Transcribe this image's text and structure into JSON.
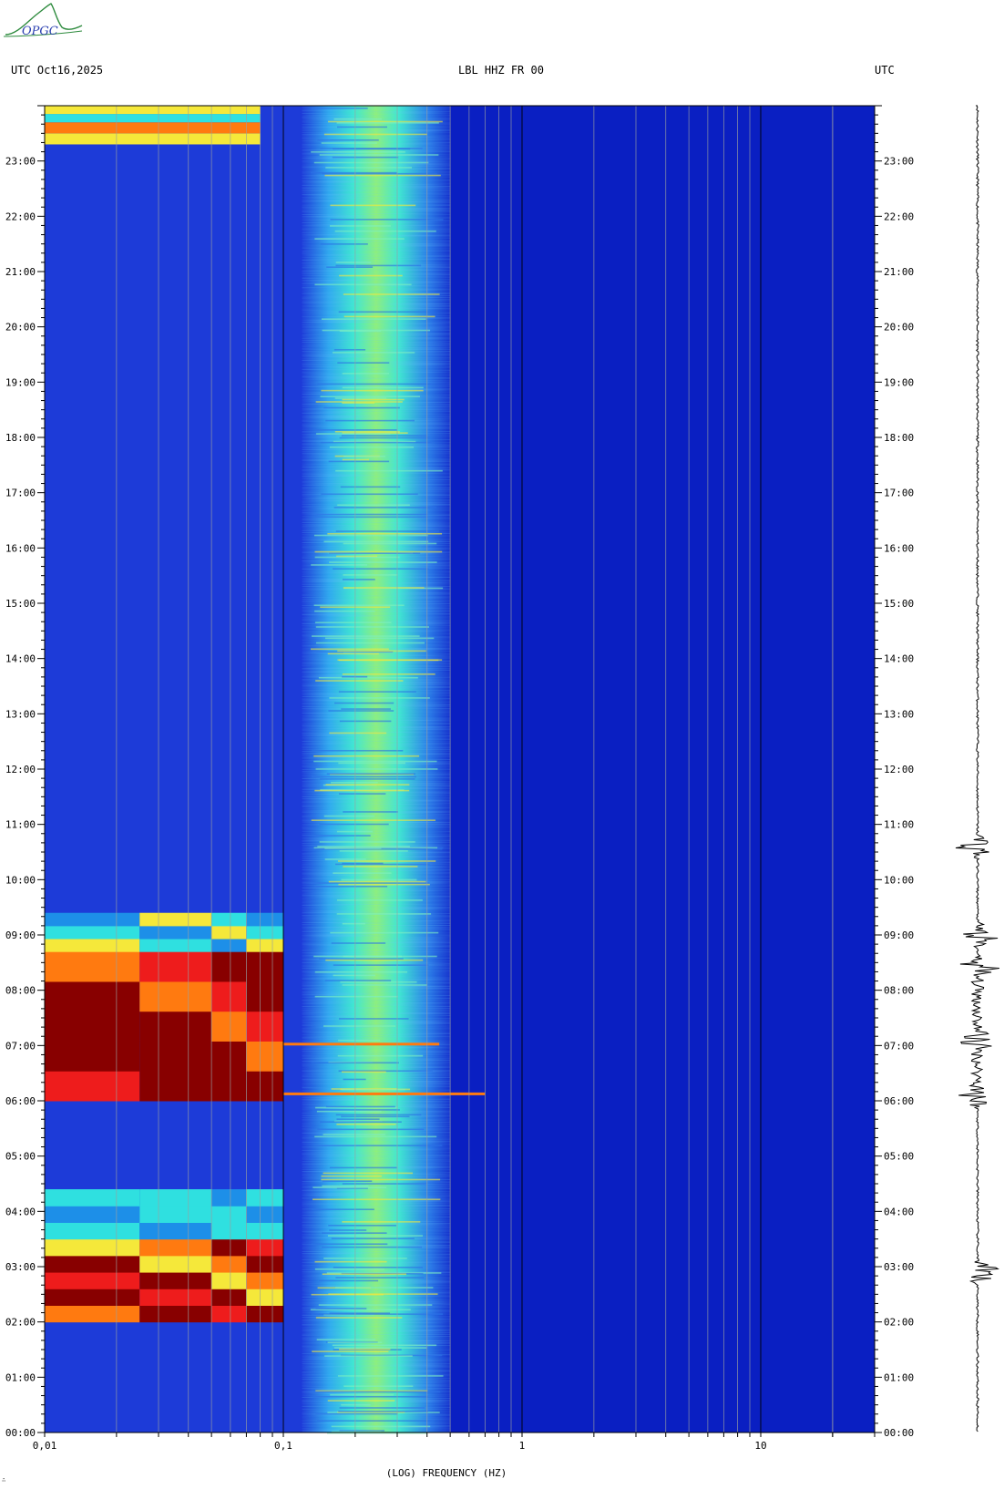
{
  "header": {
    "left": "UTC  Oct16,2025",
    "center": "LBL HHZ FR 00",
    "right": "UTC"
  },
  "logo": {
    "text": "OPGC",
    "color": "#2e8b3e"
  },
  "footer_mark": "∴",
  "colors": {
    "background_blue": "#0a1fc2",
    "low_blue": "#1d3bd8",
    "mid_cyan": "#2fe0e0",
    "yellow": "#f5e83a",
    "orange": "#ff7a10",
    "red": "#ee1c1c",
    "dark_red": "#880000"
  },
  "chart_data": {
    "type": "heatmap",
    "title": "LBL HHZ FR 00",
    "xlabel": "(LOG) FREQUENCY (HZ)",
    "ylabel": "UTC",
    "x_scale": "log",
    "xlim": [
      0.01,
      30
    ],
    "ylim": [
      0,
      24
    ],
    "x_tick_labels": [
      "0,01",
      "0,1",
      "1",
      "10"
    ],
    "x_tick_values": [
      0.01,
      0.1,
      1,
      10
    ],
    "y_tick_labels": [
      "00:00",
      "01:00",
      "02:00",
      "03:00",
      "04:00",
      "05:00",
      "06:00",
      "07:00",
      "08:00",
      "09:00",
      "10:00",
      "11:00",
      "12:00",
      "13:00",
      "14:00",
      "15:00",
      "16:00",
      "17:00",
      "18:00",
      "19:00",
      "20:00",
      "21:00",
      "22:00",
      "23:00"
    ],
    "y_tick_values": [
      0,
      1,
      2,
      3,
      4,
      5,
      6,
      7,
      8,
      9,
      10,
      11,
      12,
      13,
      14,
      15,
      16,
      17,
      18,
      19,
      20,
      21,
      22,
      23
    ],
    "microseism_band_hz": [
      0.14,
      0.45
    ],
    "high_energy_events": [
      {
        "start_hour": 2.0,
        "end_hour": 4.4,
        "fmax_hz": 0.1
      },
      {
        "start_hour": 6.0,
        "end_hour": 9.3,
        "fmax_hz": 0.1
      }
    ],
    "seismogram_events_hours": [
      2.9,
      6.1,
      7.1,
      8.4,
      9.0,
      10.6
    ]
  }
}
